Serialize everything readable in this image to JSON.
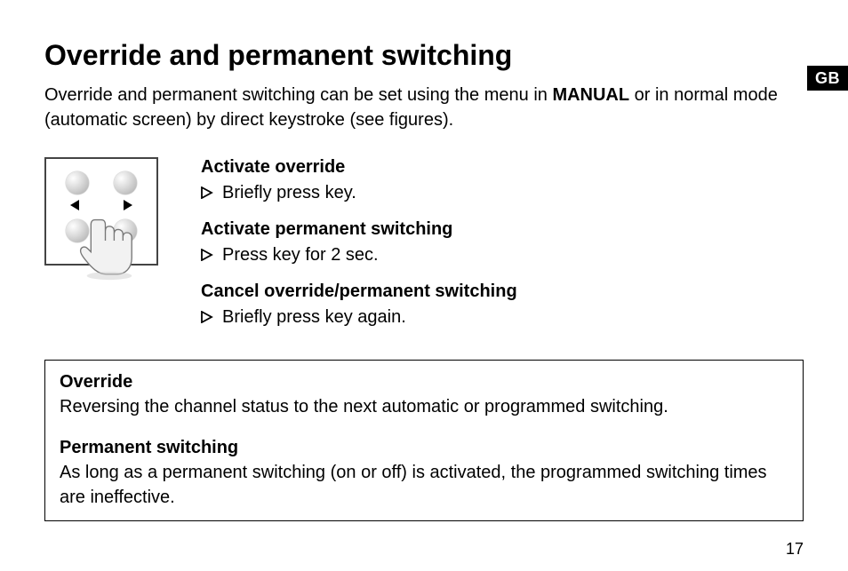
{
  "country_tab": "GB",
  "heading": "Override and permanent switching",
  "intro_pre": "Override and permanent switching can be set using the menu in ",
  "intro_bold": "MANUAL",
  "intro_post": " or in normal mode (automatic screen) by direct keystroke (see figures).",
  "steps": [
    {
      "title": "Activate override",
      "text": "Briefly press key."
    },
    {
      "title": "Activate permanent switching",
      "text": "Press key for 2 sec."
    },
    {
      "title": "Cancel override/permanent switching",
      "text": "Briefly press key again."
    }
  ],
  "definitions": [
    {
      "term": "Override",
      "text": "Reversing the channel status to the next automatic or programmed switching."
    },
    {
      "term": "Permanent switching",
      "text": "As long as a permanent switching (on or off) is activated, the programmed switching times are ineffective."
    }
  ],
  "page_number": "17"
}
